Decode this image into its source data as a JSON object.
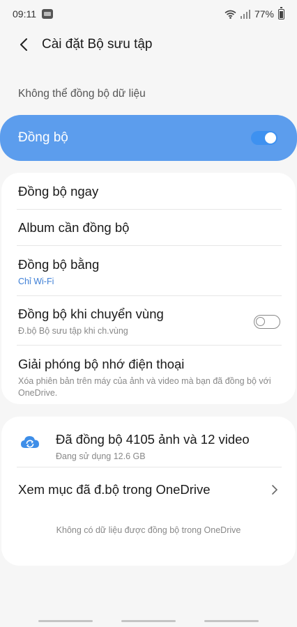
{
  "status_bar": {
    "time": "09:11",
    "battery": "77%",
    "battery_level": 0.77
  },
  "header": {
    "title": "Cài đặt Bộ sưu tập"
  },
  "sync_warning": "Không thể đồng bộ dữ liệu",
  "sync_toggle": {
    "label": "Đồng bộ",
    "enabled": true
  },
  "options": [
    {
      "title": "Đồng bộ ngay",
      "subtitle": ""
    },
    {
      "title": "Album cần đồng bộ",
      "subtitle": ""
    },
    {
      "title": "Đồng bộ bằng",
      "subtitle": "Chỉ Wi-Fi"
    },
    {
      "title": "Đồng bộ khi chuyển vùng",
      "subtitle": "Đ.bộ Bộ sưu tập khi ch.vùng",
      "toggle": false
    },
    {
      "title": "Giải phóng bộ nhớ điện thoại",
      "subtitle": "Xóa phiên bản trên máy của ảnh và video mà bạn đã đồng bộ với OneDrive."
    }
  ],
  "stats": {
    "synced": "Đã đồng bộ 4105 ảnh và 12 video",
    "usage": "Đang sử dụng 12.6 GB",
    "view_link": "Xem mục đã đ.bộ trong OneDrive",
    "empty_note": "Không có dữ liệu được đồng bộ trong OneDrive"
  },
  "colors": {
    "accent": "#5c9ded",
    "link": "#3e7fd6"
  }
}
